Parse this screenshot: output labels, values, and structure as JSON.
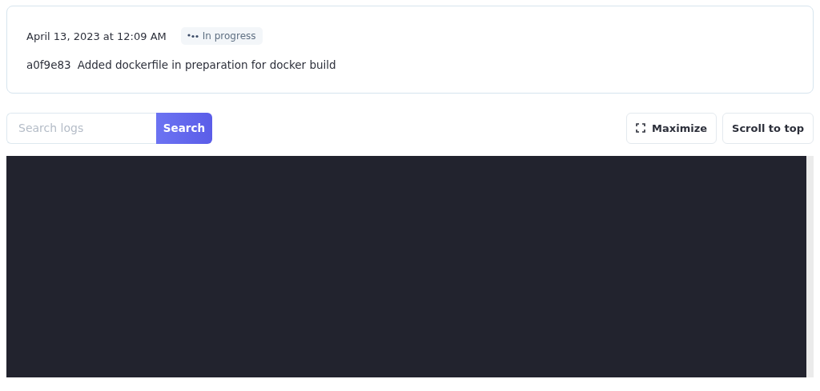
{
  "build": {
    "timestamp": "April 13, 2023 at 12:09 AM",
    "status": "In progress",
    "commit_hash": "a0f9e83",
    "commit_message": "Added dockerfile in preparation for docker build"
  },
  "toolbar": {
    "search": {
      "placeholder": "Search logs",
      "button": "Search"
    },
    "maximize": "Maximize",
    "scroll_to_top": "Scroll to top"
  }
}
